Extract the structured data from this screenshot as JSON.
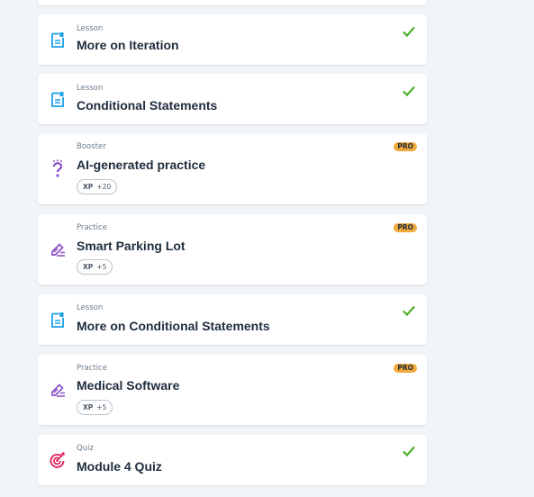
{
  "items": [
    {
      "kind": "Lesson",
      "title": "More on Iteration",
      "icon": "lesson-icon",
      "status": "completed"
    },
    {
      "kind": "Lesson",
      "title": "Conditional Statements",
      "icon": "lesson-icon",
      "status": "completed"
    },
    {
      "kind": "Booster",
      "title": "AI-generated practice",
      "icon": "booster-icon",
      "badge": "PRO",
      "xp_label": "XP",
      "xp_value": "+20"
    },
    {
      "kind": "Practice",
      "title": "Smart Parking Lot",
      "icon": "practice-icon",
      "badge": "PRO",
      "xp_label": "XP",
      "xp_value": "+5"
    },
    {
      "kind": "Lesson",
      "title": "More on Conditional Statements",
      "icon": "lesson-icon",
      "status": "completed"
    },
    {
      "kind": "Practice",
      "title": "Medical Software",
      "icon": "practice-icon",
      "badge": "PRO",
      "xp_label": "XP",
      "xp_value": "+5"
    },
    {
      "kind": "Quiz",
      "title": "Module 4 Quiz",
      "icon": "quiz-icon",
      "status": "completed"
    }
  ],
  "colors": {
    "background": "#f2f5f8",
    "lesson_icon": "#1aa0e6",
    "practice_icon": "#8a4fc9",
    "booster_icon": "#8a4fc9",
    "quiz_icon": "#e0265f",
    "check": "#4caf2a",
    "pro_badge": "#f2a93b"
  }
}
